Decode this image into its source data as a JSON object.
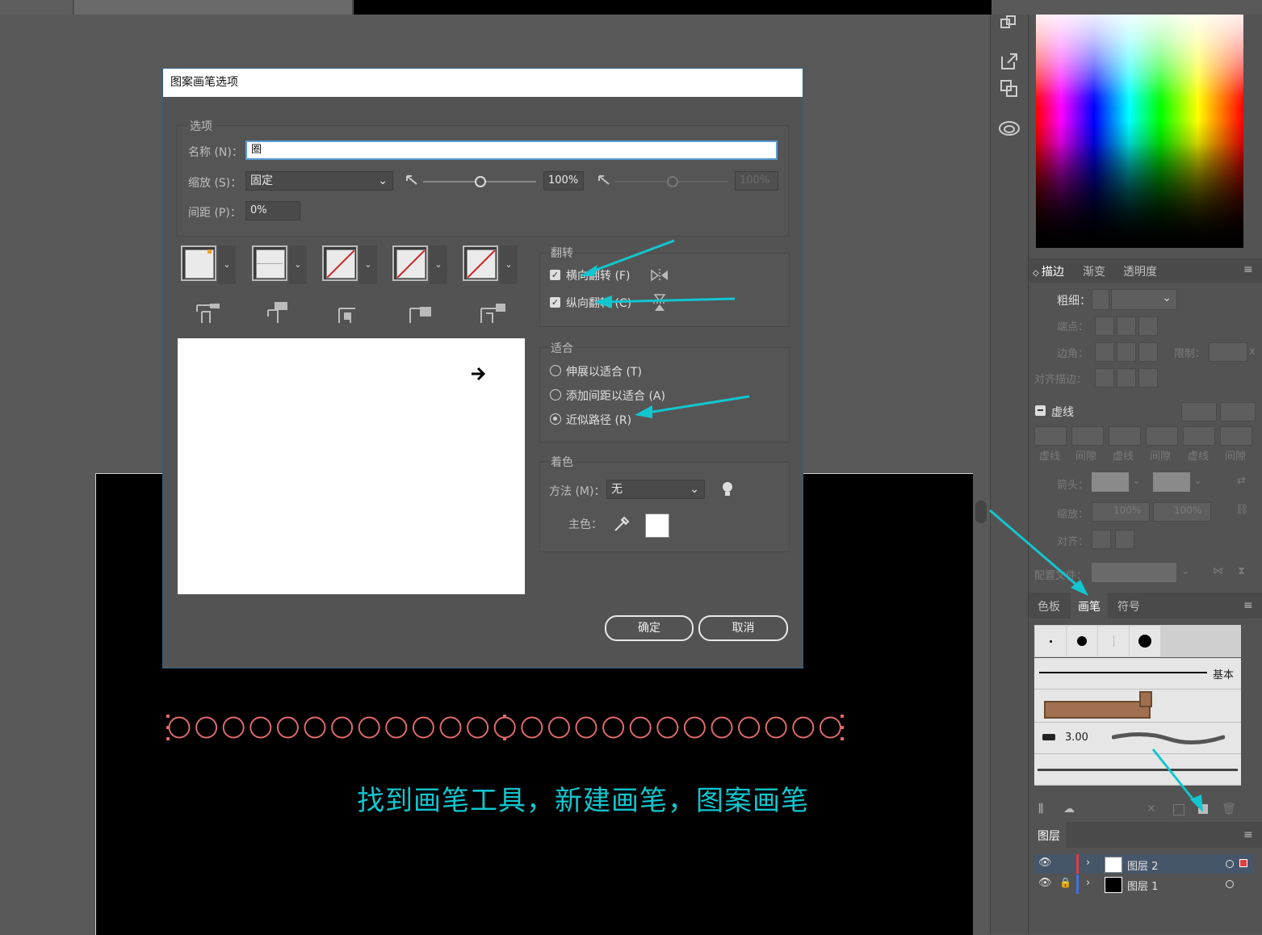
{
  "dialog": {
    "title": "图案画笔选项",
    "options_group": "选项",
    "name_label": "名称 (N)：",
    "name_value": "圈",
    "scale_label": "缩放 (S)：",
    "scale_value": "固定",
    "scale_pct": "100%",
    "scale_pct2": "100%",
    "spacing_label": "间距 (P)：",
    "spacing_value": "0%",
    "flip_group": "翻转",
    "flip_h_label": "横向翻转 (F)",
    "flip_v_label": "纵向翻转 (C)",
    "fit_group": "适合",
    "fit_options": [
      "伸展以适合 (T)",
      "添加间距以适合 (A)",
      "近似路径 (R)"
    ],
    "fit_selected": "近似路径 (R)",
    "color_group": "着色",
    "method_label": "方法 (M)：",
    "method_value": "无",
    "key_color_label": "主色：",
    "ok_button": "确定",
    "cancel_button": "取消"
  },
  "panels": {
    "stroke_tabs": [
      "描边",
      "渐变",
      "透明度"
    ],
    "weight_label": "粗细：",
    "cap_label": "端点：",
    "corner_label": "边角：",
    "limit_label": "限制：",
    "limit_suffix": "x",
    "align_label": "对齐描边：",
    "dashed_label": "虚线",
    "dash_labels": [
      "虚线",
      "间隙",
      "虚线",
      "间隙",
      "虚线",
      "间隙"
    ],
    "arrow_label": "箭头：",
    "scale_label": "缩放：",
    "scale_a": "100%",
    "scale_b": "100%",
    "align2_label": "对齐：",
    "profile_label": "配置文件：",
    "brush_tabs": [
      "色板",
      "画笔",
      "符号"
    ],
    "brush_basic": "基本",
    "brush_size": "3.00",
    "layers_title": "图层",
    "layers": [
      {
        "name": "图层 2",
        "color": "#e04040"
      },
      {
        "name": "图层 1",
        "color": "#4070e0"
      }
    ]
  },
  "caption": "找到画笔工具，新建画笔，图案画笔",
  "colors": {
    "accent": "#12c6cf",
    "pattern": "#e06a6a"
  }
}
